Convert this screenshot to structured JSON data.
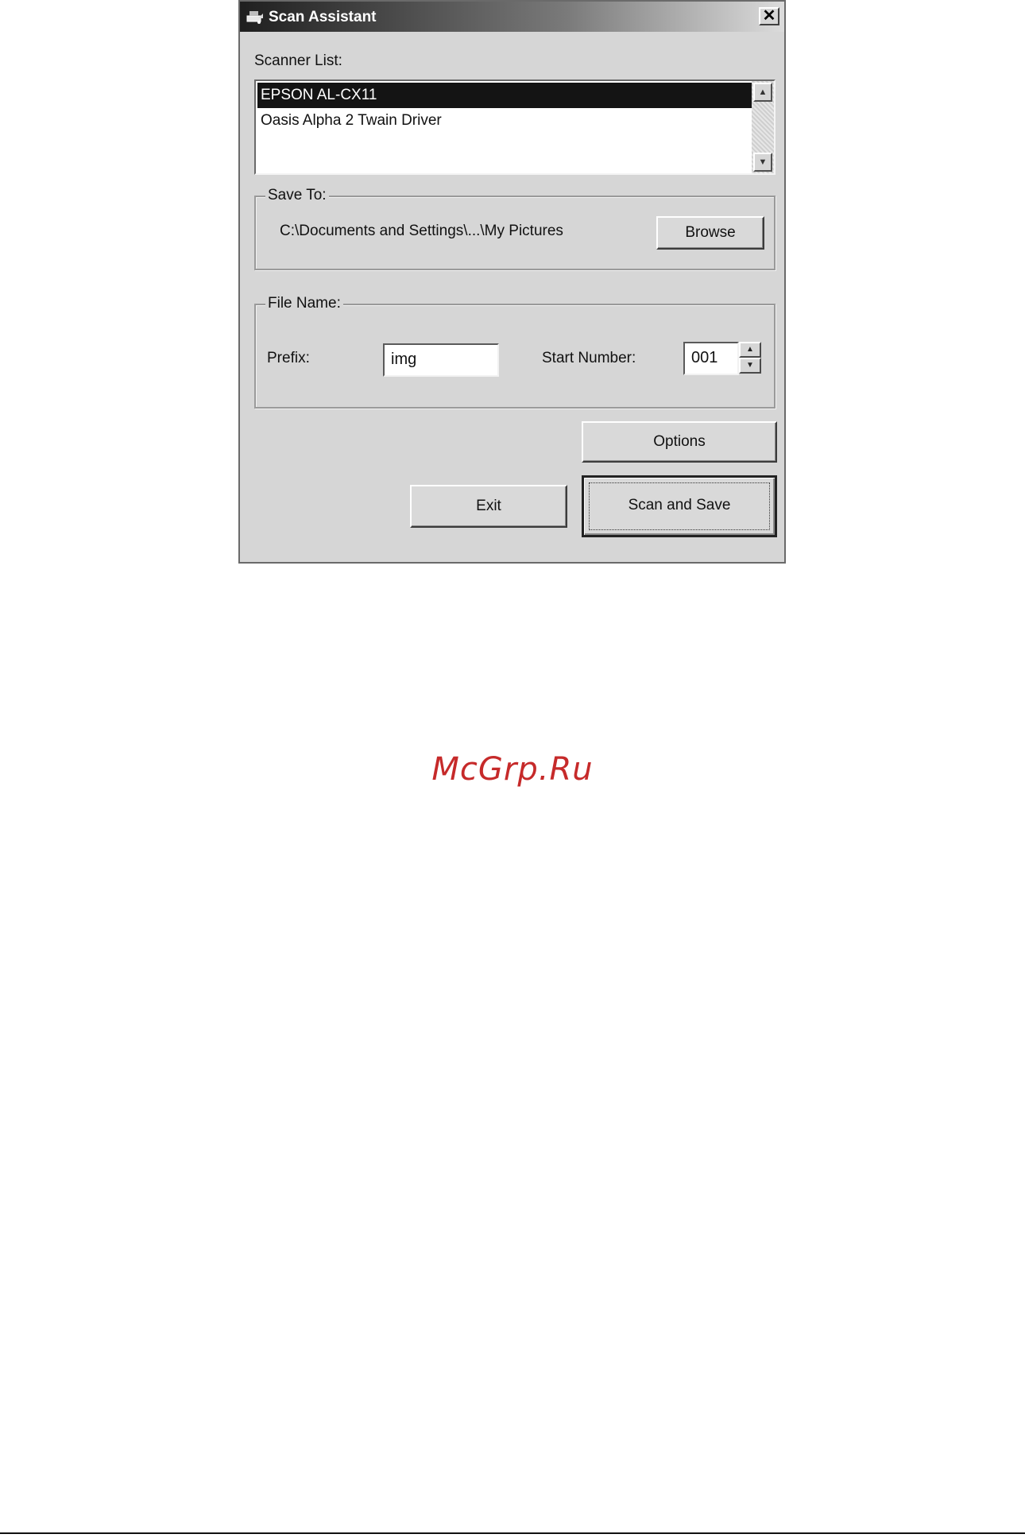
{
  "window": {
    "title": "Scan Assistant",
    "close_glyph": "✕",
    "icon": "scanner-icon"
  },
  "scanner_list": {
    "label": "Scanner List:",
    "items": [
      {
        "label": "EPSON AL-CX11",
        "selected": true
      },
      {
        "label": "Oasis Alpha 2 Twain Driver",
        "selected": false
      }
    ]
  },
  "save_to": {
    "group_label": "Save To:",
    "path": "C:\\Documents and Settings\\...\\My Pictures",
    "browse_label": "Browse"
  },
  "file_name": {
    "group_label": "File Name:",
    "prefix_label": "Prefix:",
    "prefix_value": "img",
    "start_number_label": "Start Number:",
    "start_number_value": "001"
  },
  "buttons": {
    "options": "Options",
    "exit": "Exit",
    "scan_and_save": "Scan and Save"
  },
  "watermark": "McGrp.Ru",
  "colors": {
    "dialog_bg": "#d6d6d6",
    "selection": "#141414",
    "watermark": "#c62a2a"
  }
}
